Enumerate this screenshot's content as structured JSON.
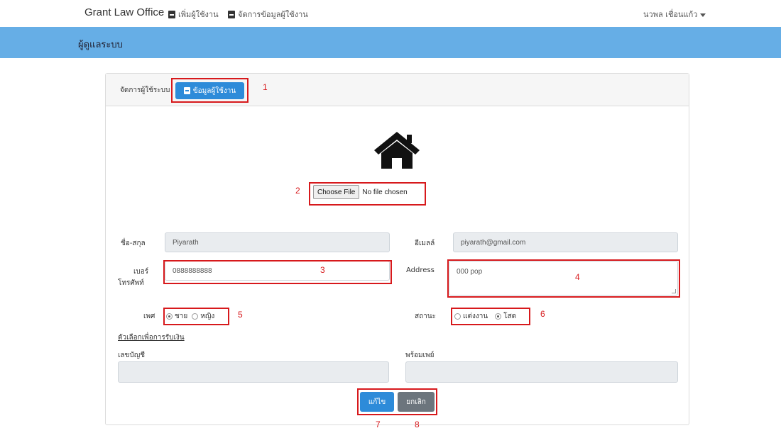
{
  "navbar": {
    "brand": "Grant Law Office",
    "links": [
      {
        "label": "เพิ่มผู้ใช้งาน",
        "icon": "id-card-icon"
      },
      {
        "label": "จัดการข้อมูลผู้ใช้งาน",
        "icon": "id-card-icon"
      }
    ],
    "user_name": "นวพล เชื่อนแก้ว"
  },
  "band": {
    "title": "ผู้ดูแลระบบ"
  },
  "card": {
    "header_label": "จัดการผู้ใช้ระบบ",
    "user_info_button": "ข้อมูลผู้ใช้งาน",
    "file": {
      "button": "Choose File",
      "status": "No file chosen"
    },
    "form": {
      "name_label": "ชื่อ-สกุล",
      "name_value": "Piyarath",
      "email_label": "อีเมลล์",
      "email_value": "piyarath@gmail.com",
      "phone_label_1": "เบอร์",
      "phone_label_2": "โทรศัพท์",
      "phone_value": "0888888888",
      "address_label": "Address",
      "address_value": "000 pop",
      "gender_label": "เพศ",
      "gender_options": [
        "ชาย",
        "หญิง"
      ],
      "gender_selected": "ชาย",
      "status_label": "สถานะ",
      "status_options": [
        "แต่งงาน",
        "โสด"
      ],
      "status_selected": "โสด",
      "payment_section": "ตัวเลือกเพื่อการรับเงิน",
      "account_label": "เลขบัญชี",
      "account_value": "",
      "promptpay_label": "พร้อมเพย์",
      "promptpay_value": ""
    },
    "buttons": {
      "edit": "แก้ไข",
      "cancel": "ยกเลิก"
    }
  },
  "annotations": [
    "1",
    "2",
    "3",
    "4",
    "5",
    "6",
    "7",
    "8"
  ],
  "colors": {
    "band": "#66aee6",
    "primary": "#2d8bd9",
    "secondary": "#6c757d",
    "annotation": "#d7191c"
  }
}
